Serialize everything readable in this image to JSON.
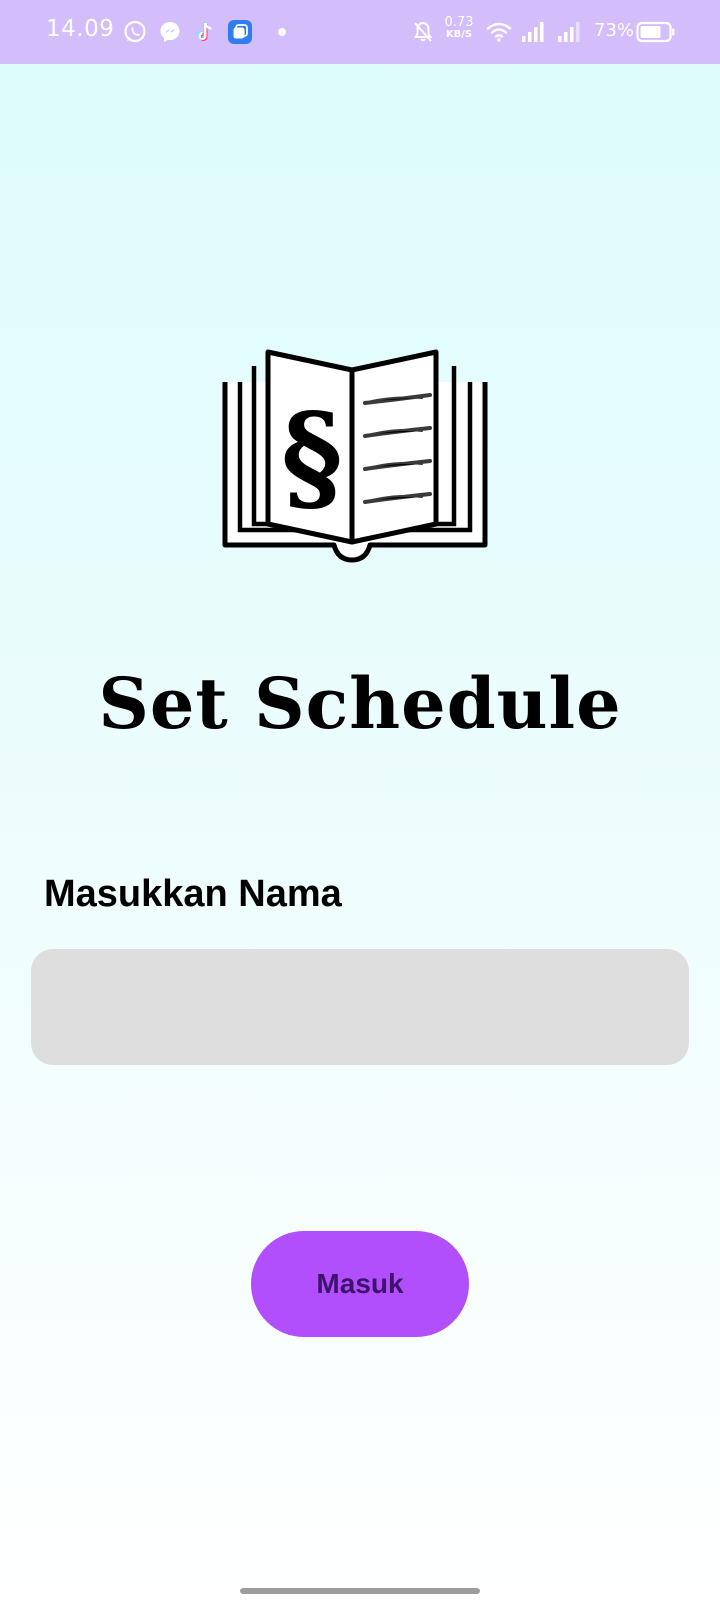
{
  "status_bar": {
    "time": "14.09",
    "net_speed_value": "0.73",
    "net_speed_unit": "KB/S",
    "battery_percent": "73%",
    "background_color": "#d4bdfb",
    "left_icons": [
      "whatsapp-icon",
      "messenger-icon",
      "tiktok-icon",
      "app-icon",
      "more-notifications-dot"
    ],
    "right_icons": [
      "bell-muted-icon",
      "wifi-icon",
      "signal-icon",
      "signal-icon",
      "battery-icon"
    ]
  },
  "logo": {
    "icon": "open-book-section-sign-icon",
    "symbol": "§"
  },
  "title": "Set Schedule",
  "form": {
    "name_label": "Masukkan Nama",
    "name_value": "",
    "name_placeholder": ""
  },
  "login_button": {
    "label": "Masuk",
    "color": "#b14ffc"
  }
}
